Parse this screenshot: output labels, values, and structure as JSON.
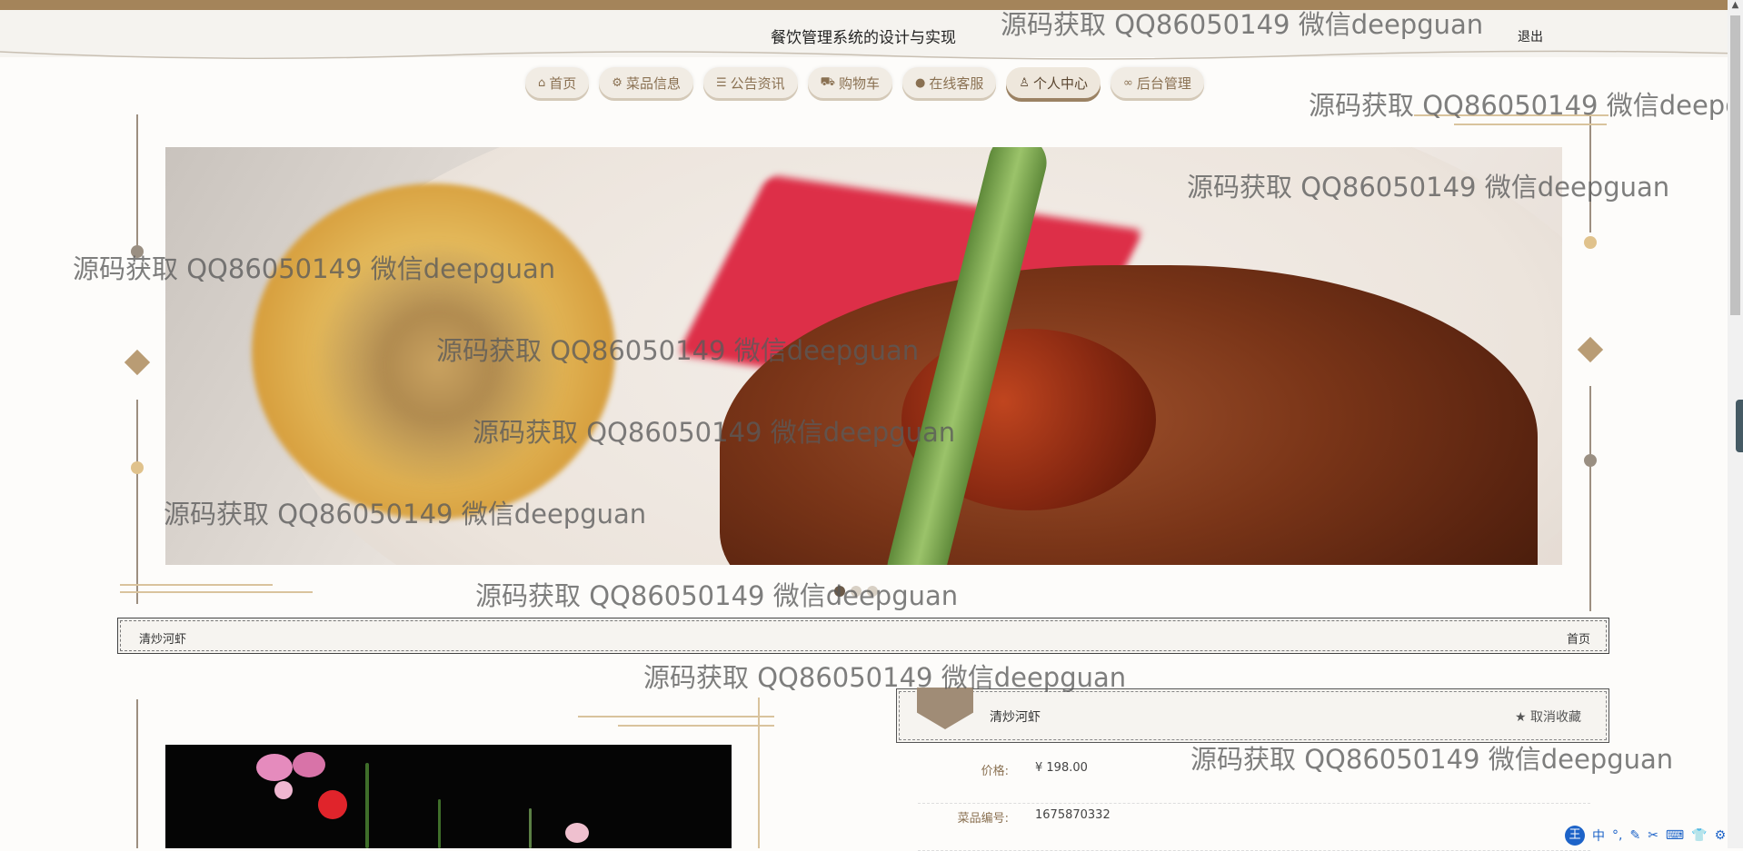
{
  "header": {
    "site_title": "餐饮管理系统的设计与实现",
    "logout_label": "退出"
  },
  "nav": {
    "items": [
      {
        "icon": "home-icon",
        "label": "首页"
      },
      {
        "icon": "gear-icon",
        "label": "菜品信息"
      },
      {
        "icon": "sliders-icon",
        "label": "公告资讯"
      },
      {
        "icon": "cart-icon",
        "label": "购物车"
      },
      {
        "icon": "chat-icon",
        "label": "在线客服"
      },
      {
        "icon": "user-icon",
        "label": "个人中心"
      },
      {
        "icon": "link-icon",
        "label": "后台管理"
      }
    ],
    "active": "个人中心"
  },
  "carousel": {
    "dots": 3,
    "active_index": 0
  },
  "breadcrumb": {
    "current": "清炒河虾",
    "home": "首页"
  },
  "product": {
    "title": "清炒河虾",
    "unfavorite_label": "取消收藏",
    "fields": [
      {
        "label": "价格:",
        "value": "¥ 198.00"
      },
      {
        "label": "菜品编号:",
        "value": "1675870332"
      }
    ]
  },
  "watermark": "源码获取 QQ86050149 微信deepguan",
  "ime_toolbar": {
    "logo": "王",
    "items": [
      "中",
      "°,",
      "✎",
      "✂",
      "⌨",
      "👕",
      "⚙"
    ]
  },
  "colors": {
    "accent": "#a4845a",
    "nav_text": "#8a7152",
    "frame": "#9d8f80",
    "gold": "#d9c39d"
  }
}
